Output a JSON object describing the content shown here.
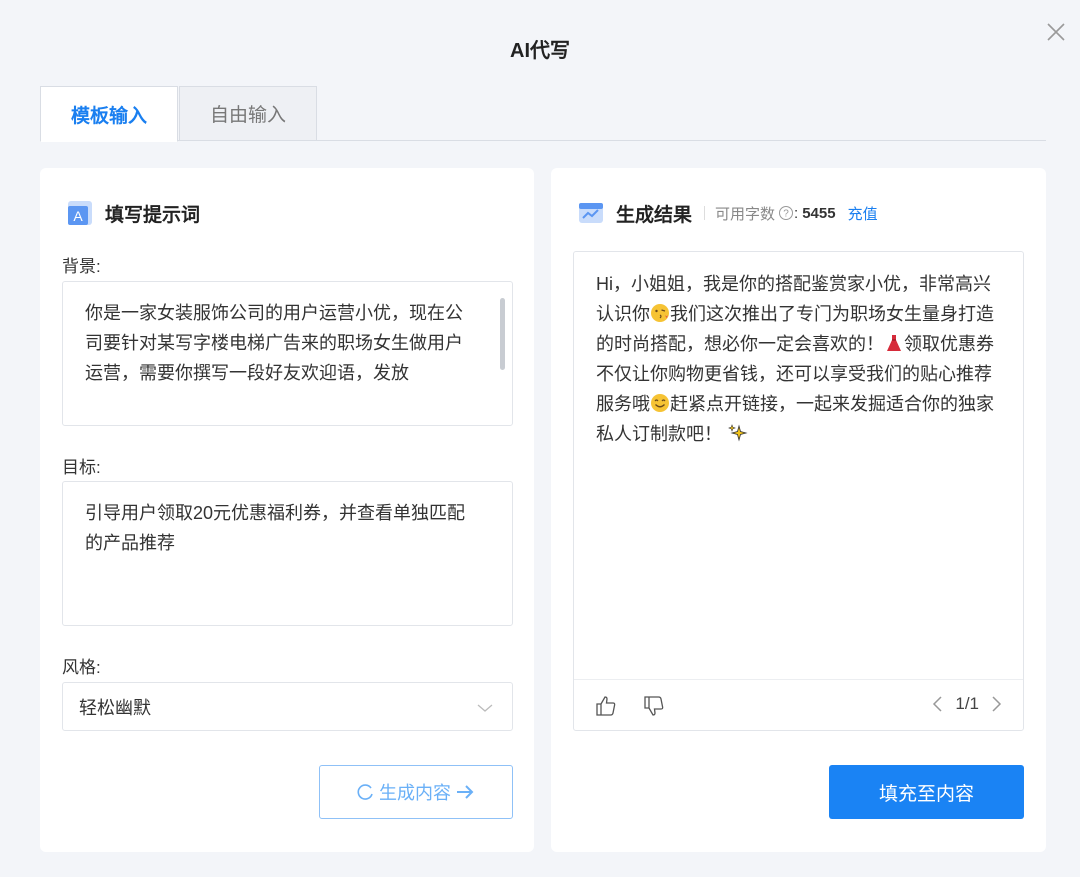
{
  "dialog": {
    "title": "AI代写"
  },
  "tabs": [
    {
      "label": "模板输入",
      "active": true
    },
    {
      "label": "自由输入",
      "active": false
    }
  ],
  "left_panel": {
    "title": "填写提示词",
    "background": {
      "label": "背景:",
      "value": "你是一家女装服饰公司的用户运营小优，现在公司要针对某写字楼电梯广告来的职场女生做用户运营，需要你撰写一段好友欢迎语，发放"
    },
    "goal": {
      "label": "目标:",
      "value": "引导用户领取20元优惠福利券，并查看单独匹配的产品推荐"
    },
    "style": {
      "label": "风格:",
      "selected": "轻松幽默"
    },
    "generate_button": "生成内容"
  },
  "right_panel": {
    "title": "生成结果",
    "available_label": "可用字数",
    "available_count": "5455",
    "recharge": "充值",
    "result": {
      "part1": "Hi，小姐姐，我是你的搭配鉴赏家小优，非常高兴认识你",
      "part2": "我们这次推出了专门为职场女生量身打造的时尚搭配，想必你一定会喜欢的！",
      "part3": "领取优惠券不仅让你购物更省钱，还可以享受我们的贴心推荐服务哦",
      "part4": "赶紧点开链接，一起来发掘适合你的独家私人订制款吧！"
    },
    "pager": "1/1",
    "fill_button": "填充至内容"
  },
  "colors": {
    "accent": "#1a83f4",
    "background": "#f3f5f9"
  }
}
